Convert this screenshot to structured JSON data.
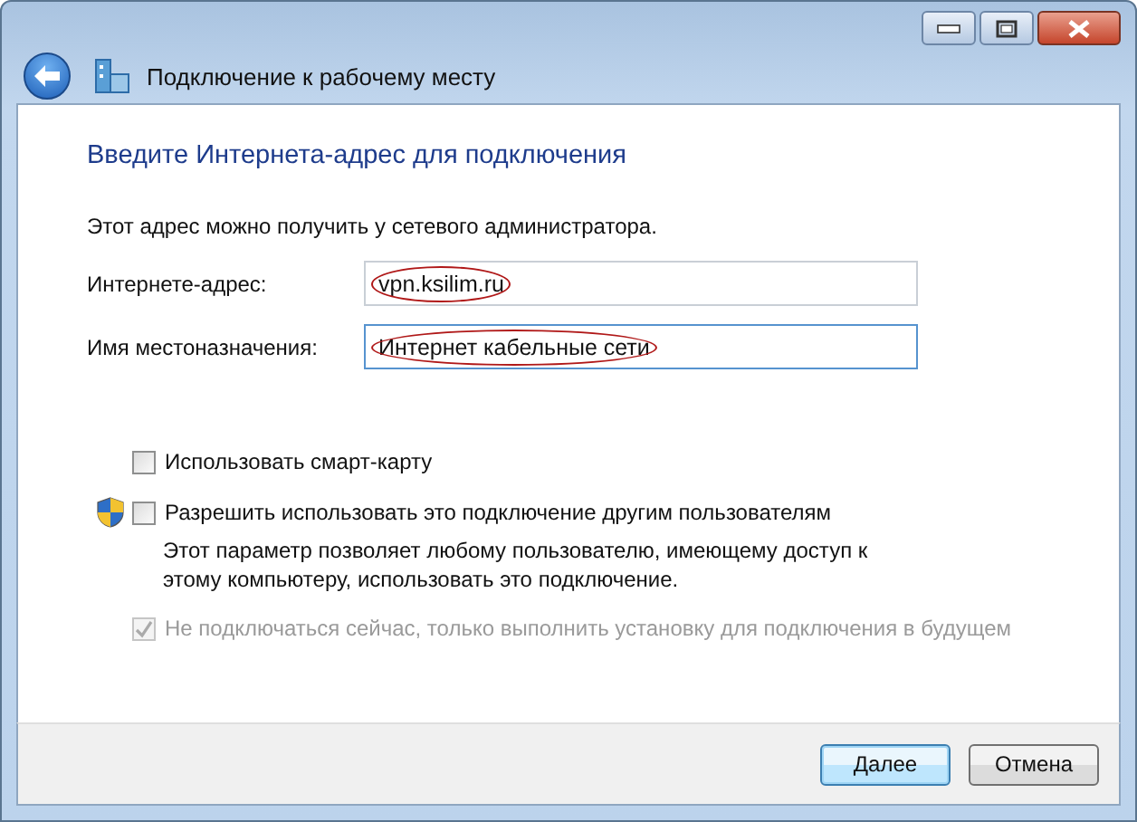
{
  "window": {
    "title": "Подключение к рабочему месту"
  },
  "heading": "Введите Интернета-адрес для подключения",
  "intro": "Этот адрес можно получить у сетевого администратора.",
  "fields": [
    {
      "label": "Интернете-адрес:",
      "value": "vpn.ksilim.ru",
      "circled": true,
      "focused": false
    },
    {
      "label": "Имя местоназначения:",
      "value": "Интернет кабельные сети",
      "circled": true,
      "focused": true
    }
  ],
  "options": [
    {
      "label": "Использовать смарт-карту",
      "checked": false,
      "disabled": false,
      "shield": false
    },
    {
      "label": "Разрешить использовать это подключение другим пользователям",
      "checked": false,
      "disabled": false,
      "shield": true,
      "description": "Этот параметр позволяет любому пользователю, имеющему доступ к этому компьютеру, использовать это подключение."
    },
    {
      "label": "Не подключаться сейчас, только выполнить установку для подключения в будущем",
      "checked": true,
      "disabled": true,
      "shield": false
    }
  ],
  "buttons": [
    {
      "label": "Далее",
      "default": true
    },
    {
      "label": "Отмена",
      "default": false
    }
  ]
}
